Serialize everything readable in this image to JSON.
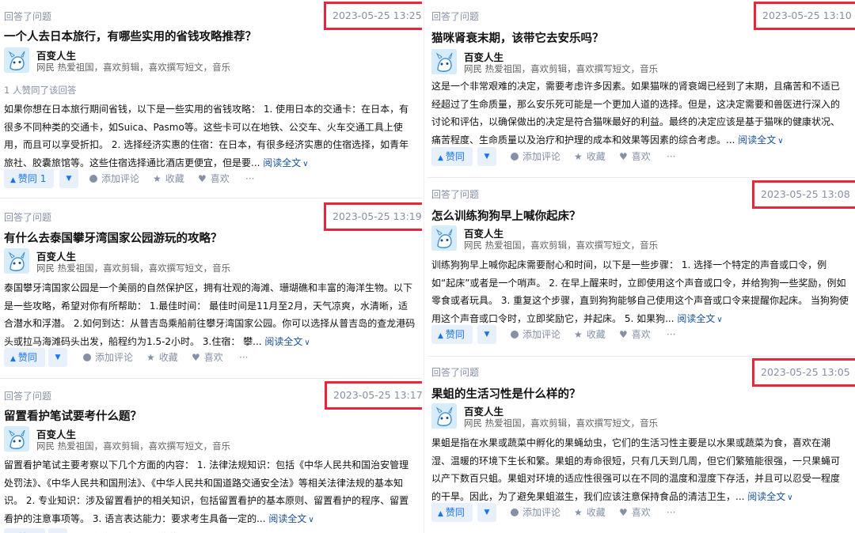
{
  "common": {
    "answered_label": "回答了问题",
    "author_name": "百变人生",
    "author_bio": "网民 热爱祖国，喜欢剪辑，喜欢撰写短文，音乐",
    "read_more": "阅读全文",
    "comment": "添加评论",
    "collect": "收藏",
    "like": "喜欢",
    "more": "···"
  },
  "left": [
    {
      "timestamp": "2023-05-25 13:25",
      "title": "一个人去日本旅行，有哪些实用的省钱攻略推荐？",
      "vote_tip": "1 人赞同了该回答",
      "excerpt": "如果你想在日本旅行期间省钱，以下是一些实用的省钱攻略： 1. 使用日本的交通卡：在日本，有很多不同种类的交通卡，如Suica、Pasmo等。这些卡可以在地铁、公交车、火车交通工具上使用，而且可以享受折扣。 2. 选择经济实惠的住宿：在日本，有很多经济实惠的住宿选择，如青年旅社、胶囊旅馆等。这些住宿选择通比酒店更便宜，但是要...",
      "vote_label": "赞同 1"
    },
    {
      "timestamp": "2023-05-25 13:19",
      "title": "有什么去泰国攀牙湾国家公园游玩的攻略？",
      "excerpt": "泰国攀牙湾国家公园是一个美丽的自然保护区，拥有壮观的海滩、珊瑚礁和丰富的海洋生物。以下是一些攻略，希望对你有所帮助： 1.最佳时间： 最佳时间是11月至2月，天气凉爽，水清晰，适合潜水和浮潜。 2.如何到达：从普吉岛乘船前往攀牙湾国家公园。你可以选择从普吉岛的查龙港码头或拉马海滩码头出发，船程约为1.5-2小时。 3.住宿： 攀...",
      "vote_label": "赞同"
    },
    {
      "timestamp": "2023-05-25 13:17",
      "title": "留置看护笔试要考什么题？",
      "excerpt": "留置看护笔试主要考察以下几个方面的内容： 1. 法律法规知识：包括《中华人民共和国治安管理处罚法》、《中华人民共和国刑法》、《中华人民共和国道路交通安全法》等相关法律法规的基本知识。 2. 专业知识：涉及留置看护的相关知识，包括留置看护的基本原则、留置看护的程序、留置看护的注意事项等。 3. 语言表达能力：要求考生具备一定的...",
      "vote_label": "赞同"
    }
  ],
  "right": [
    {
      "timestamp": "2023-05-25 13:10",
      "title": "猫咪肾衰末期，该带它去安乐吗？",
      "excerpt": "这是一个非常艰难的决定，需要考虑许多因素。如果猫咪的肾衰竭已经到了末期，且痛苦和不适已经超过了生命质量，那么安乐死可能是一个更加人道的选择。但是，这决定需要和兽医进行深入的讨论和评估，以确保做出的决定是符合猫咪最好的利益。最终的决定应该是基于猫咪的健康状况、痛苦程度、生命质量以及治疗和护理的成本和效果等因素的综合考虑。...",
      "vote_label": "赞同"
    },
    {
      "timestamp": "2023-05-25 13:08",
      "title": "怎么训练狗狗早上喊你起床？",
      "excerpt": "训练狗狗早上喊你起床需要耐心和时间，以下是一些步骤： 1. 选择一个特定的声音或口令，例如“起床”或者是一个哨声。 2. 在早上醒来时，立即使用这个声音或口令，并给狗狗一些奖励，例如零食或者玩具。 3. 重复这个步骤，直到狗狗能够自己使用这个声音或口令来提醒你起床。 当狗狗使用这个声音或口令时，立即奖励它，并起床。 5. 如果狗...",
      "vote_label": "赞同"
    },
    {
      "timestamp": "2023-05-25 13:05",
      "title": "果蛆的生活习性是什么样的？",
      "excerpt": "果蛆是指在水果或蔬菜中孵化的果蝇幼虫，它们的生活习性主要是以水果或蔬菜为食，喜欢在潮湿、温暖的环境下生长和繁。果蛆的寿命很短，只有几天到几周，但它们繁殖能很强，一只果蝇可以产下数百只蛆。果蛆对环境的适应性很强可以在不同的温度和湿度下存活，并且可以忍受一程度的干旱。因此，为了避免果蛆滋生，我们应该注意保持食品的清洁卫生，...",
      "vote_label": "赞同"
    }
  ]
}
